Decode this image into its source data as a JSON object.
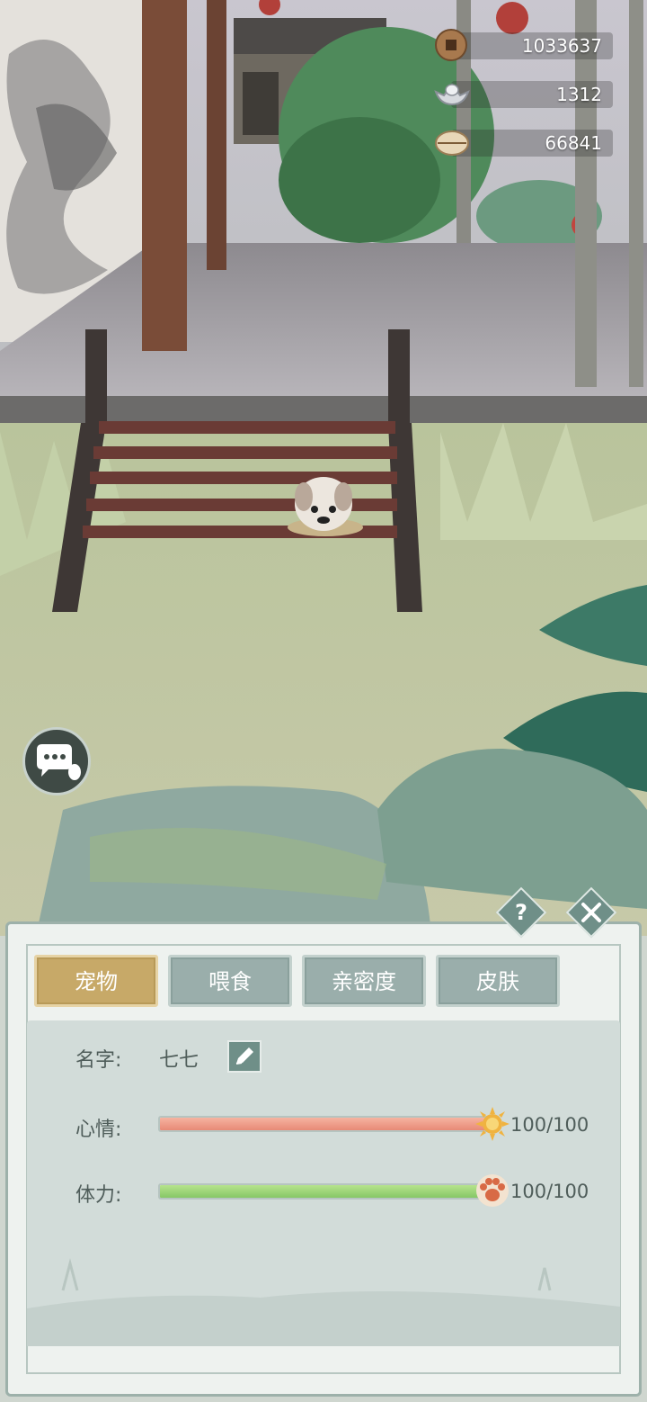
{
  "currency": [
    {
      "icon": "copper-coin-icon",
      "value": "1033637"
    },
    {
      "icon": "silver-ingot-icon",
      "value": "1312"
    },
    {
      "icon": "shell-icon",
      "value": "66841"
    }
  ],
  "chat_button": {
    "icon": "chat-bubble-icon"
  },
  "panel": {
    "help_label": "?",
    "close_icon": "close-icon",
    "tabs": [
      {
        "label": "宠物",
        "active": true
      },
      {
        "label": "喂食",
        "active": false
      },
      {
        "label": "亲密度",
        "active": false
      },
      {
        "label": "皮肤",
        "active": false
      }
    ],
    "name_label": "名字:",
    "name_value": "七七",
    "mood_label": "心情:",
    "mood_value": "100/100",
    "mood_fraction": 1.0,
    "stamina_label": "体力:",
    "stamina_value": "100/100",
    "stamina_fraction": 1.0
  },
  "colors": {
    "active_tab": "#c7a968",
    "tab": "#9aaeab",
    "mood_fill": "#e88a76",
    "stamina_fill": "#86c766"
  }
}
